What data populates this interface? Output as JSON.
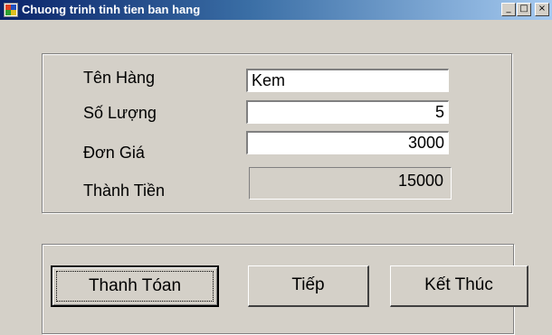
{
  "window": {
    "title": "Chuong trinh tinh tien ban hang",
    "controls": {
      "minimize": "_",
      "maximize": "□",
      "close": "×"
    }
  },
  "form": {
    "ten_hang": {
      "label": "Tên Hàng",
      "value": "Kem"
    },
    "so_luong": {
      "label": "Số Lượng",
      "value": "5"
    },
    "don_gia": {
      "label": "Đơn Giá",
      "value": "3000"
    },
    "thanh_tien": {
      "label": "Thành Tiền",
      "value": "15000"
    }
  },
  "buttons": {
    "thanh_toan": "Thanh Tóan",
    "tiep": "Tiếp",
    "ket_thuc": "Kết Thúc"
  },
  "colors": {
    "face": "#d4d0c8",
    "title_start": "#0a246a",
    "title_end": "#a6caf0"
  }
}
